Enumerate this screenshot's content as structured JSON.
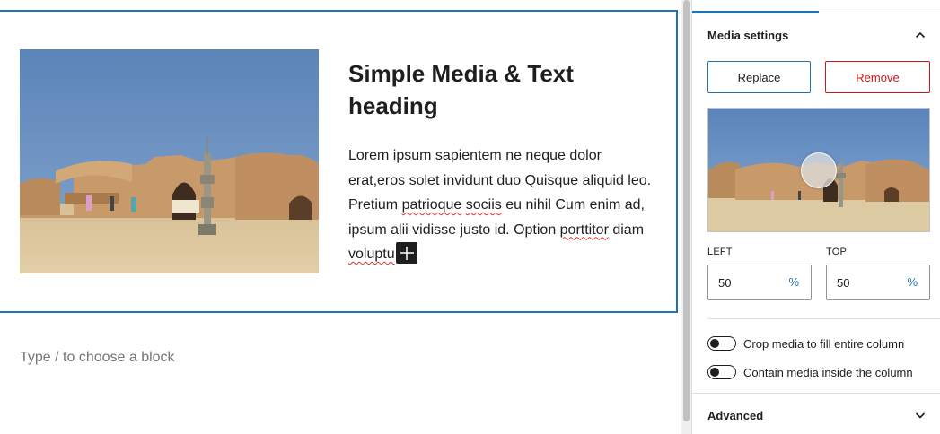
{
  "editor": {
    "heading": "Simple Media & Text heading",
    "paragraph_parts": [
      "Lorem ipsum sapientem ne neque dolor erat,eros solet invidunt duo Quisque aliquid leo. Pretium ",
      "patrioque",
      " ",
      "sociis",
      " eu nihil Cum enim ad, ipsum alii vidisse justo id. Option ",
      "porttitor",
      " diam ",
      "voluptu"
    ],
    "appender_placeholder": "Type / to choose a block",
    "media_icon": "plus-icon"
  },
  "sidebar": {
    "media_settings": {
      "title": "Media settings",
      "replace_label": "Replace",
      "remove_label": "Remove",
      "focal_point": {
        "left_label": "LEFT",
        "top_label": "TOP",
        "left_value": "50",
        "top_value": "50",
        "unit": "%"
      },
      "crop_label": "Crop media to fill entire column",
      "contain_label": "Contain media inside the column",
      "crop_on": false,
      "contain_on": false
    },
    "advanced": {
      "title": "Advanced"
    }
  },
  "colors": {
    "accent": "#2271b1",
    "danger": "#cc1818"
  }
}
